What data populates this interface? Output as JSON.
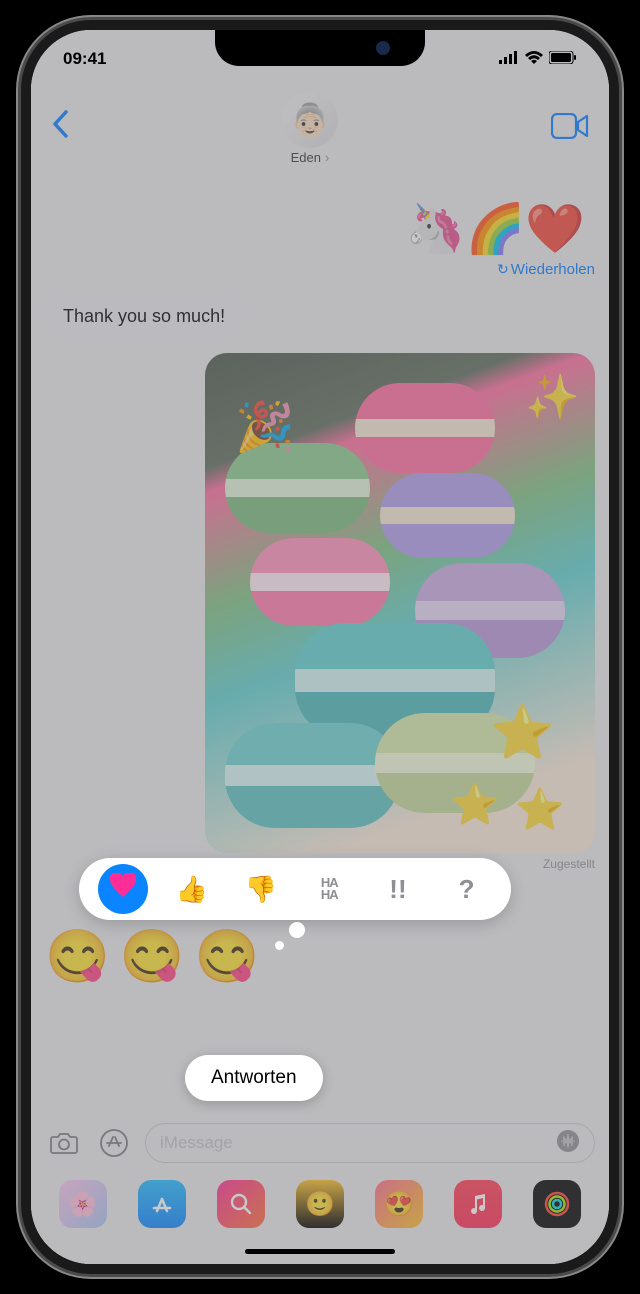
{
  "status": {
    "time": "09:41"
  },
  "header": {
    "contact_name": "Eden"
  },
  "messages": {
    "sticker_row": [
      "🦄",
      "🌈",
      "❤️"
    ],
    "retry_label": "Wiederholen",
    "incoming_text": "Thank you so much!",
    "photo_overlays": {
      "party": "🎉",
      "sparkle": "✨",
      "star": "⭐"
    },
    "delivered_label": "Zugestellt",
    "emoji_reply": [
      "😋",
      "😋",
      "😋"
    ]
  },
  "tapback": {
    "items": [
      "heart",
      "thumbs-up",
      "thumbs-down",
      "haha",
      "exclaim",
      "question"
    ],
    "labels": {
      "haha_line1": "HA",
      "haha_line2": "HA",
      "exclaim": "!!",
      "question": "?"
    },
    "selected": "heart"
  },
  "reply_popup": {
    "label": "Antworten"
  },
  "input": {
    "placeholder": "iMessage"
  },
  "dock": {
    "apps": [
      "photos",
      "app-store",
      "images-search",
      "memoji",
      "animoji",
      "music",
      "fitness"
    ]
  }
}
